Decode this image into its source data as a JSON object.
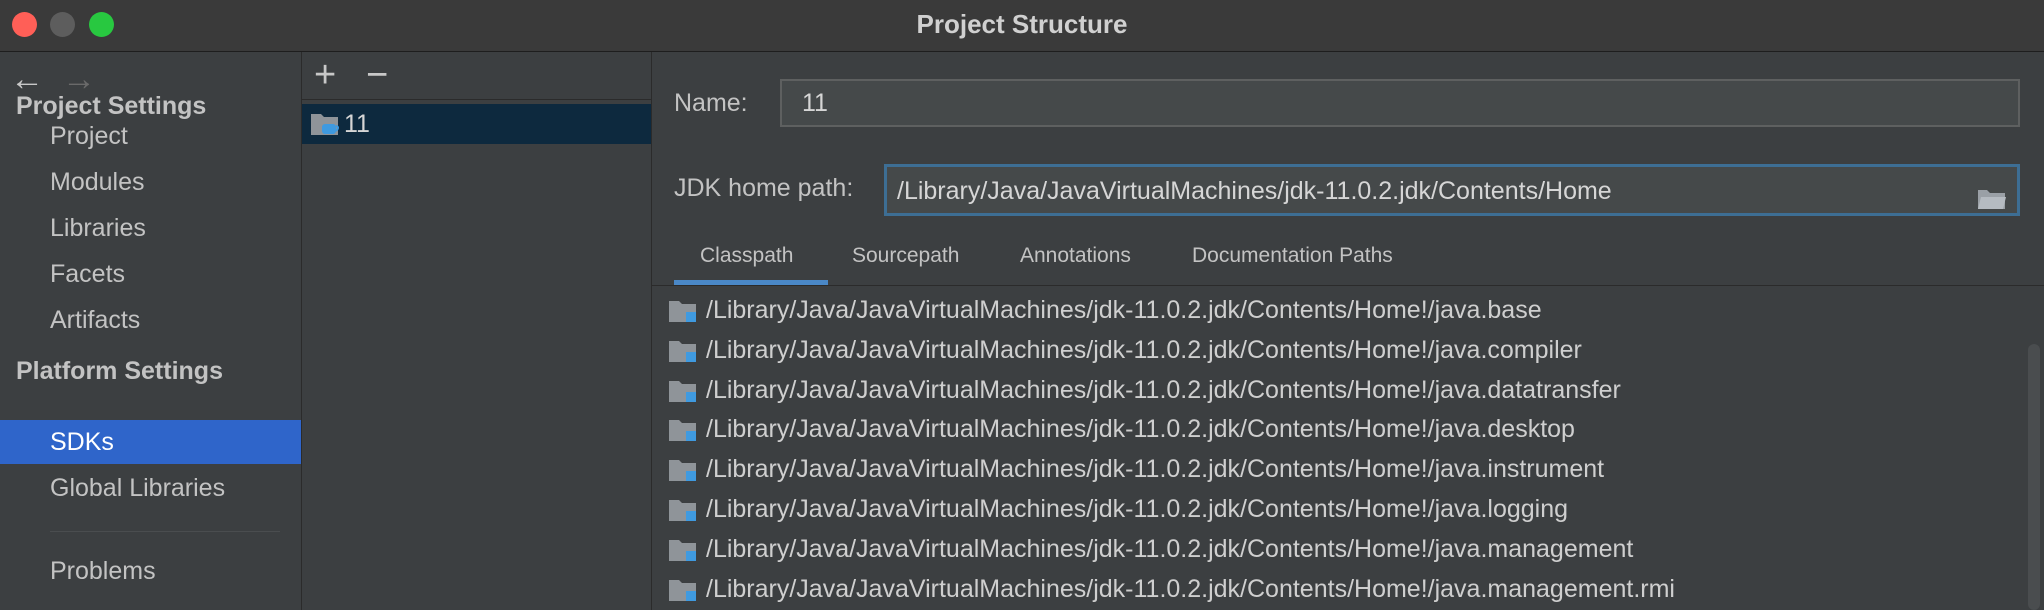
{
  "window": {
    "title": "Project Structure"
  },
  "nav": {
    "back": "←",
    "forward": "→",
    "project_settings_heading": "Project Settings",
    "project_settings_items": [
      "Project",
      "Modules",
      "Libraries",
      "Facets",
      "Artifacts"
    ],
    "platform_settings_heading": "Platform Settings",
    "platform_settings_items": [
      "SDKs",
      "Global Libraries"
    ],
    "selected": "SDKs",
    "problems": "Problems"
  },
  "sdk_list": {
    "add": "+",
    "remove": "−",
    "items": [
      "11"
    ]
  },
  "detail": {
    "name_label": "Name:",
    "name_value": "11",
    "jdk_label": "JDK home path:",
    "jdk_value": "/Library/Java/JavaVirtualMachines/jdk-11.0.2.jdk/Contents/Home",
    "tabs": [
      "Classpath",
      "Sourcepath",
      "Annotations",
      "Documentation Paths"
    ],
    "active_tab": "Classpath",
    "classpath": [
      "/Library/Java/JavaVirtualMachines/jdk-11.0.2.jdk/Contents/Home!/java.base",
      "/Library/Java/JavaVirtualMachines/jdk-11.0.2.jdk/Contents/Home!/java.compiler",
      "/Library/Java/JavaVirtualMachines/jdk-11.0.2.jdk/Contents/Home!/java.datatransfer",
      "/Library/Java/JavaVirtualMachines/jdk-11.0.2.jdk/Contents/Home!/java.desktop",
      "/Library/Java/JavaVirtualMachines/jdk-11.0.2.jdk/Contents/Home!/java.instrument",
      "/Library/Java/JavaVirtualMachines/jdk-11.0.2.jdk/Contents/Home!/java.logging",
      "/Library/Java/JavaVirtualMachines/jdk-11.0.2.jdk/Contents/Home!/java.management",
      "/Library/Java/JavaVirtualMachines/jdk-11.0.2.jdk/Contents/Home!/java.management.rmi"
    ]
  },
  "colors": {
    "selection": "#2f65ca",
    "list_selection": "#0d293e",
    "focus_border": "#3d6e94",
    "tab_underline": "#4a88c7",
    "close": "#ff5f57",
    "maximize": "#28c840"
  }
}
